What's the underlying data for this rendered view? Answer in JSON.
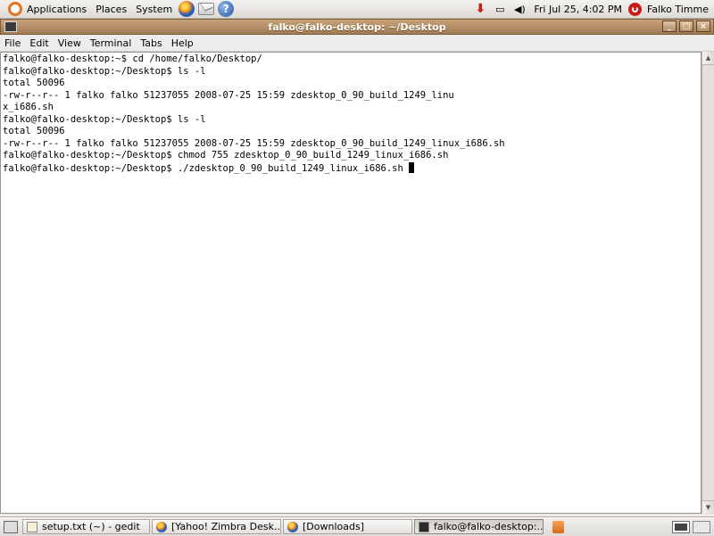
{
  "top_panel": {
    "menus": [
      "Applications",
      "Places",
      "System"
    ],
    "launchers": [
      {
        "icon": "firefox-icon"
      },
      {
        "icon": "mail-icon"
      },
      {
        "icon": "help-icon",
        "glyph": "?"
      }
    ],
    "clock": "Fri Jul 25,  4:02 PM",
    "user": "Falko Timme"
  },
  "window": {
    "title": "falko@falko-desktop: ~/Desktop",
    "buttons": {
      "minimize": "_",
      "maximize": "□",
      "close": "×"
    },
    "menu": [
      "File",
      "Edit",
      "View",
      "Terminal",
      "Tabs",
      "Help"
    ]
  },
  "terminal": {
    "lines": [
      "falko@falko-desktop:~$ cd /home/falko/Desktop/",
      "falko@falko-desktop:~/Desktop$ ls -l",
      "total 50096",
      "-rw-r--r-- 1 falko falko 51237055 2008-07-25 15:59 zdesktop_0_90_build_1249_linu",
      "x_i686.sh",
      "falko@falko-desktop:~/Desktop$ ls -l",
      "total 50096",
      "-rw-r--r-- 1 falko falko 51237055 2008-07-25 15:59 zdesktop_0_90_build_1249_linux_i686.sh",
      "falko@falko-desktop:~/Desktop$ chmod 755 zdesktop_0_90_build_1249_linux_i686.sh"
    ],
    "current_line": "falko@falko-desktop:~/Desktop$ ./zdesktop_0_90_build_1249_linux_i686.sh "
  },
  "taskbar": {
    "tasks": [
      {
        "label": "setup.txt (~) - gedit",
        "icon": "gedit"
      },
      {
        "label": "[Yahoo! Zimbra Desk...",
        "icon": "firefox"
      },
      {
        "label": "[Downloads]",
        "icon": "firefox"
      },
      {
        "label": "falko@falko-desktop:...",
        "icon": "term"
      }
    ]
  }
}
